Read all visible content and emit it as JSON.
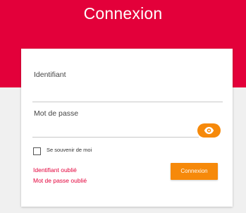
{
  "header": {
    "title": "Connexion"
  },
  "form": {
    "username": {
      "label": "Identifiant",
      "value": ""
    },
    "password": {
      "label": "Mot de passe",
      "value": "",
      "toggle_icon": "eye-icon"
    },
    "remember_me": {
      "label": "Se souvenir de moi",
      "checked": false
    },
    "forgot_username_link": "Identifiant oublié",
    "forgot_password_link": "Mot de passe oublié",
    "submit_label": "Connexion"
  },
  "colors": {
    "brand_red": "#e3003a",
    "accent_orange": "#f6890a",
    "background_gray": "#f0f0f0"
  }
}
